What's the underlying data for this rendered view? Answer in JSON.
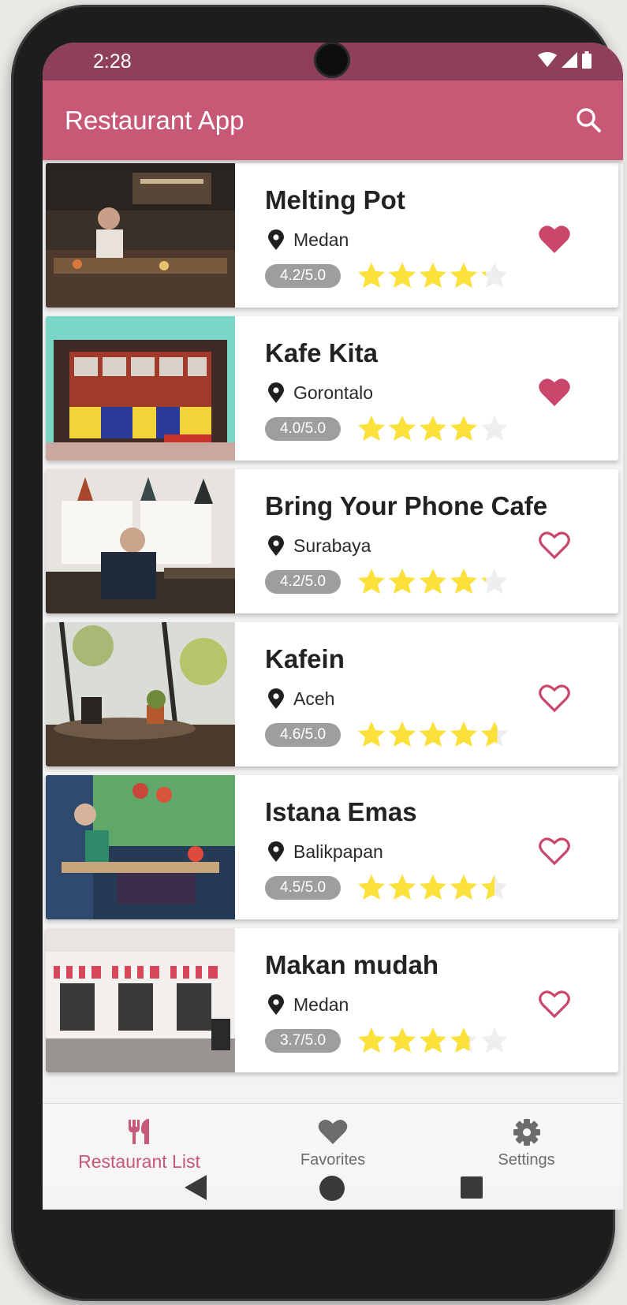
{
  "status": {
    "time": "2:28"
  },
  "appbar": {
    "title": "Restaurant App",
    "search_icon": "search-icon"
  },
  "colors": {
    "primary": "#c75977",
    "primary_dark": "#8e3f5c",
    "star": "#fbe13a",
    "badge": "#9e9e9e",
    "favorite": "#c9476a"
  },
  "restaurants": [
    {
      "name": "Melting Pot",
      "city": "Medan",
      "rating_label": "4.2/5.0",
      "rating": 4.2,
      "favorite": true
    },
    {
      "name": "Kafe Kita",
      "city": "Gorontalo",
      "rating_label": "4.0/5.0",
      "rating": 4.0,
      "favorite": true
    },
    {
      "name": "Bring Your Phone Cafe",
      "city": "Surabaya",
      "rating_label": "4.2/5.0",
      "rating": 4.2,
      "favorite": false
    },
    {
      "name": "Kafein",
      "city": "Aceh",
      "rating_label": "4.6/5.0",
      "rating": 4.6,
      "favorite": false
    },
    {
      "name": "Istana Emas",
      "city": "Balikpapan",
      "rating_label": "4.5/5.0",
      "rating": 4.5,
      "favorite": false
    },
    {
      "name": "Makan mudah",
      "city": "Medan",
      "rating_label": "3.7/5.0",
      "rating": 3.7,
      "favorite": false
    }
  ],
  "bottom_nav": [
    {
      "label": "Restaurant List",
      "icon": "restaurant-icon",
      "active": true
    },
    {
      "label": "Favorites",
      "icon": "heart-icon",
      "active": false
    },
    {
      "label": "Settings",
      "icon": "gear-icon",
      "active": false
    }
  ],
  "system_nav": {
    "back_icon": "back-triangle-icon",
    "home_icon": "home-circle-icon",
    "recents_icon": "recents-square-icon"
  }
}
